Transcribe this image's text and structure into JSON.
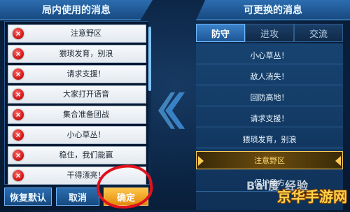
{
  "left_panel": {
    "title": "局内使用的消息",
    "messages": [
      {
        "text": "注意野区"
      },
      {
        "text": "猥琐发育，别浪"
      },
      {
        "text": "请求支援！"
      },
      {
        "text": "大家打开语音"
      },
      {
        "text": "集合准备团战"
      },
      {
        "text": "小心草丛！"
      },
      {
        "text": "稳住，我们能赢"
      },
      {
        "text": "干得漂亮！"
      }
    ],
    "delete_icon": "×"
  },
  "buttons": {
    "restore": "恢复默认",
    "cancel": "取消",
    "confirm": "确定"
  },
  "right_panel": {
    "title": "可更换的消息",
    "tabs": [
      {
        "label": "防守",
        "active": true
      },
      {
        "label": "进攻",
        "active": false
      },
      {
        "label": "交流",
        "active": false
      }
    ],
    "options": [
      {
        "text": "小心草丛！"
      },
      {
        "text": "敌人消失！"
      },
      {
        "text": "回防高地！"
      },
      {
        "text": "请求支援！"
      },
      {
        "text": "猥琐发育，别浪"
      },
      {
        "text": "注意野区",
        "selected": true
      },
      {
        "text": "保护我方"
      }
    ]
  },
  "watermarks": {
    "baidu": "Bai度 经验",
    "site": "京华手游网"
  },
  "colors": {
    "accent": "#5fb7ff",
    "delete": "#d31b1b",
    "confirm": "#e28b0a",
    "selected_border": "#ffcc55",
    "annotation_circle": "#e0121d"
  }
}
